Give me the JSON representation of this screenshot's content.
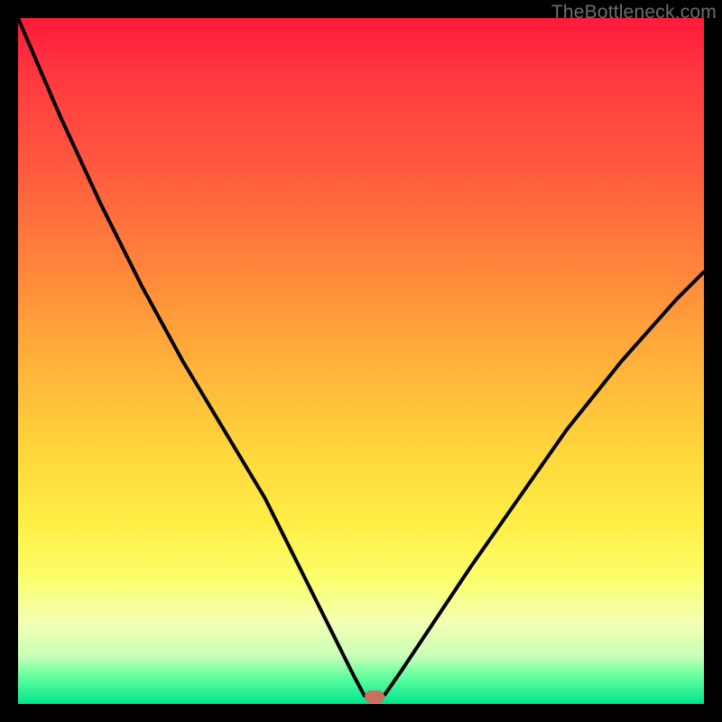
{
  "watermark": "TheBottleneck.com",
  "marker": {
    "x_frac": 0.52,
    "y_frac": 0.99
  },
  "chart_data": {
    "type": "line",
    "title": "",
    "xlabel": "",
    "ylabel": "",
    "xlim": [
      0,
      100
    ],
    "ylim": [
      0,
      100
    ],
    "series": [
      {
        "name": "bottleneck-curve",
        "x": [
          0,
          6,
          12,
          18,
          24,
          30,
          36,
          40,
          44,
          47,
          49,
          50.5,
          52,
          53.5,
          56,
          60,
          66,
          73,
          80,
          88,
          96,
          100
        ],
        "y_from_top": [
          0,
          14,
          27,
          39,
          50,
          60,
          70,
          78,
          86,
          92,
          96,
          98.8,
          99.2,
          98.6,
          95,
          89,
          80,
          70,
          60,
          50,
          41,
          37
        ]
      }
    ],
    "annotations": [
      {
        "kind": "marker",
        "x": 52,
        "y_from_top": 99,
        "color": "#c96f62"
      }
    ],
    "background_gradient": {
      "orientation": "vertical",
      "stops": [
        {
          "pos": 0.0,
          "color": "#ff1a3a"
        },
        {
          "pos": 0.22,
          "color": "#ff5a3f"
        },
        {
          "pos": 0.52,
          "color": "#ffb63a"
        },
        {
          "pos": 0.74,
          "color": "#ffef47"
        },
        {
          "pos": 0.93,
          "color": "#c9ffb8"
        },
        {
          "pos": 1.0,
          "color": "#00e58b"
        }
      ]
    }
  }
}
